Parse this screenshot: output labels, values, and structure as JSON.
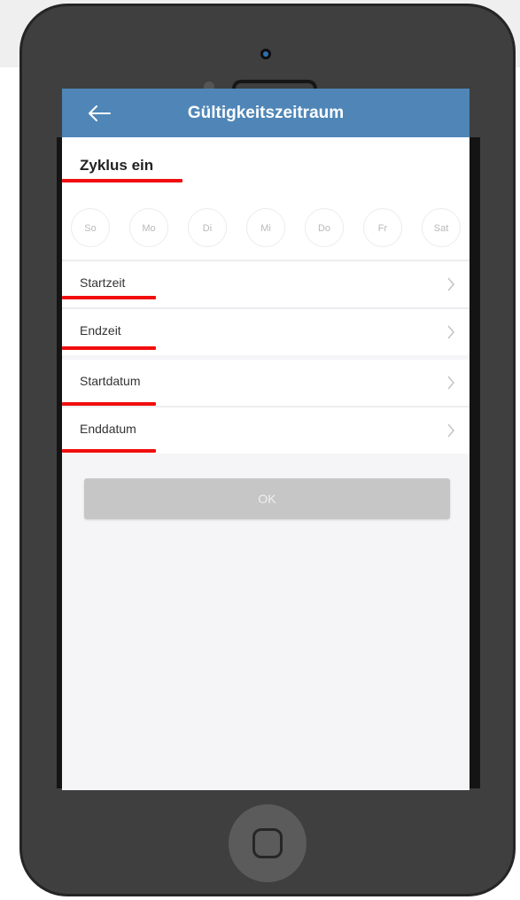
{
  "header": {
    "title": "Gültigkeitszeitraum"
  },
  "cycle": {
    "title": "Zyklus ein",
    "days": [
      {
        "label": "So"
      },
      {
        "label": "Mo"
      },
      {
        "label": "Di"
      },
      {
        "label": "Mi"
      },
      {
        "label": "Do"
      },
      {
        "label": "Fr"
      },
      {
        "label": "Sat"
      }
    ]
  },
  "rows": [
    {
      "label": "Startzeit"
    },
    {
      "label": "Endzeit"
    },
    {
      "label": "Startdatum"
    },
    {
      "label": "Enddatum"
    }
  ],
  "ok_button": {
    "label": "OK"
  },
  "colors": {
    "header": "#4f86b7",
    "annotation": "#f10d0d",
    "button_disabled": "#c6c6c6"
  },
  "icons": {
    "back": "arrow-left-icon",
    "chevron": "chevron-right-icon",
    "home": "home-button-icon"
  }
}
